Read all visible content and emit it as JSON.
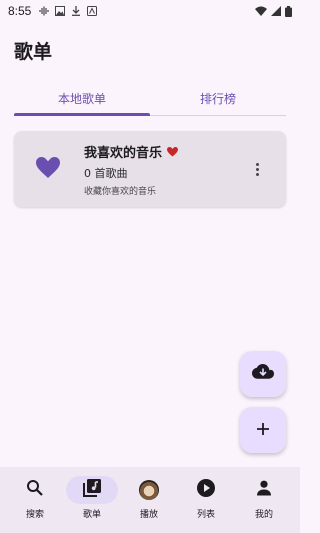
{
  "status_bar": {
    "time": "8:55"
  },
  "header": {
    "title": "歌单"
  },
  "tabs": [
    {
      "label": "本地歌单",
      "active": true
    },
    {
      "label": "排行榜",
      "active": false
    }
  ],
  "playlist": {
    "title": "我喜欢的音乐",
    "count": "0 首歌曲",
    "description": "收藏你喜欢的音乐"
  },
  "bottom_nav": [
    {
      "label": "搜索",
      "icon": "search-icon"
    },
    {
      "label": "歌单",
      "icon": "library-music-icon",
      "active": true
    },
    {
      "label": "播放",
      "icon": "avatar"
    },
    {
      "label": "列表",
      "icon": "play-circle-icon"
    },
    {
      "label": "我的",
      "icon": "person-icon"
    }
  ],
  "colors": {
    "accent": "#6a4fb0",
    "heart": "#c62828",
    "background": "#fcf4fd",
    "card": "#e7e0e8",
    "fab": "#e9ddff"
  }
}
